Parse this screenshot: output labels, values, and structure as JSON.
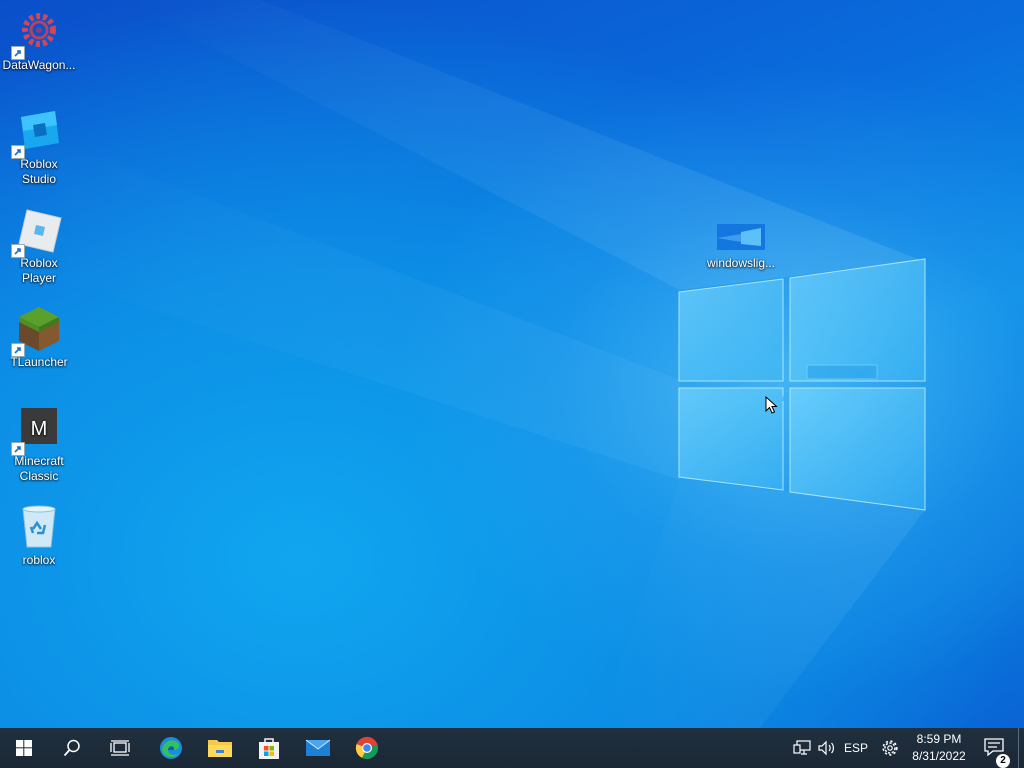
{
  "desktop": {
    "icons": [
      {
        "label": "DataWagon...",
        "icon": "datawagon-gear-icon",
        "shortcut": true
      },
      {
        "label": "Roblox Studio",
        "icon": "roblox-studio-icon",
        "shortcut": true
      },
      {
        "label": "Roblox Player",
        "icon": "roblox-player-icon",
        "shortcut": true
      },
      {
        "label": "TLauncher",
        "icon": "tlauncher-grass-block-icon",
        "shortcut": true
      },
      {
        "label": "Minecraft Classic",
        "icon": "minecraft-classic-m-icon",
        "shortcut": true
      },
      {
        "label": "roblox",
        "icon": "recycle-bin-icon",
        "shortcut": false
      }
    ],
    "file_icon": {
      "label": "windowslig...",
      "icon": "image-file-icon"
    }
  },
  "taskbar": {
    "pinned": [
      "start-button",
      "search",
      "task-view",
      "edge",
      "file-explorer",
      "microsoft-store",
      "mail",
      "chrome"
    ],
    "tray": {
      "language": "ESP",
      "time": "8:59 PM",
      "date": "8/31/2022",
      "notification_count": "2"
    }
  },
  "colors": {
    "taskbar": "#1d2a39",
    "desktop_blue": "#0a72d6",
    "logo_glow": "#6fd3ff"
  }
}
